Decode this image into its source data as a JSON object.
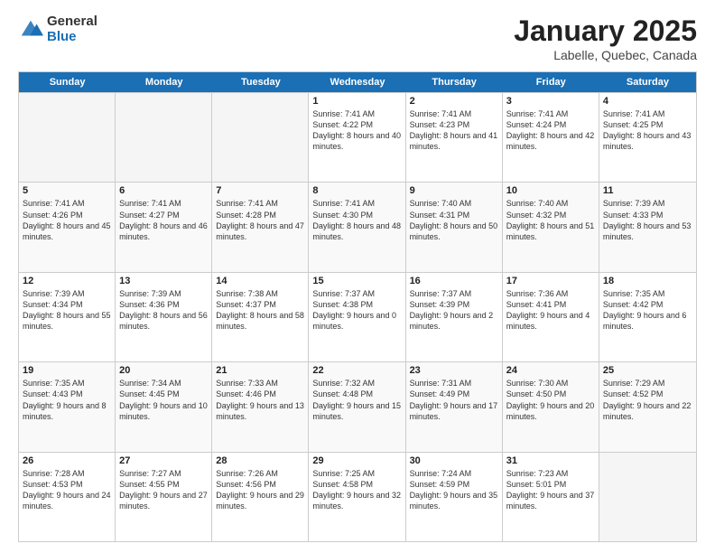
{
  "logo": {
    "general": "General",
    "blue": "Blue"
  },
  "title": "January 2025",
  "subtitle": "Labelle, Quebec, Canada",
  "days": [
    "Sunday",
    "Monday",
    "Tuesday",
    "Wednesday",
    "Thursday",
    "Friday",
    "Saturday"
  ],
  "rows": [
    [
      {
        "day": "",
        "empty": true
      },
      {
        "day": "",
        "empty": true
      },
      {
        "day": "",
        "empty": true
      },
      {
        "day": "1",
        "sunrise": "7:41 AM",
        "sunset": "4:22 PM",
        "daylight": "8 hours and 40 minutes."
      },
      {
        "day": "2",
        "sunrise": "7:41 AM",
        "sunset": "4:23 PM",
        "daylight": "8 hours and 41 minutes."
      },
      {
        "day": "3",
        "sunrise": "7:41 AM",
        "sunset": "4:24 PM",
        "daylight": "8 hours and 42 minutes."
      },
      {
        "day": "4",
        "sunrise": "7:41 AM",
        "sunset": "4:25 PM",
        "daylight": "8 hours and 43 minutes."
      }
    ],
    [
      {
        "day": "5",
        "sunrise": "7:41 AM",
        "sunset": "4:26 PM",
        "daylight": "8 hours and 45 minutes."
      },
      {
        "day": "6",
        "sunrise": "7:41 AM",
        "sunset": "4:27 PM",
        "daylight": "8 hours and 46 minutes."
      },
      {
        "day": "7",
        "sunrise": "7:41 AM",
        "sunset": "4:28 PM",
        "daylight": "8 hours and 47 minutes."
      },
      {
        "day": "8",
        "sunrise": "7:41 AM",
        "sunset": "4:30 PM",
        "daylight": "8 hours and 48 minutes."
      },
      {
        "day": "9",
        "sunrise": "7:40 AM",
        "sunset": "4:31 PM",
        "daylight": "8 hours and 50 minutes."
      },
      {
        "day": "10",
        "sunrise": "7:40 AM",
        "sunset": "4:32 PM",
        "daylight": "8 hours and 51 minutes."
      },
      {
        "day": "11",
        "sunrise": "7:39 AM",
        "sunset": "4:33 PM",
        "daylight": "8 hours and 53 minutes."
      }
    ],
    [
      {
        "day": "12",
        "sunrise": "7:39 AM",
        "sunset": "4:34 PM",
        "daylight": "8 hours and 55 minutes."
      },
      {
        "day": "13",
        "sunrise": "7:39 AM",
        "sunset": "4:36 PM",
        "daylight": "8 hours and 56 minutes."
      },
      {
        "day": "14",
        "sunrise": "7:38 AM",
        "sunset": "4:37 PM",
        "daylight": "8 hours and 58 minutes."
      },
      {
        "day": "15",
        "sunrise": "7:37 AM",
        "sunset": "4:38 PM",
        "daylight": "9 hours and 0 minutes."
      },
      {
        "day": "16",
        "sunrise": "7:37 AM",
        "sunset": "4:39 PM",
        "daylight": "9 hours and 2 minutes."
      },
      {
        "day": "17",
        "sunrise": "7:36 AM",
        "sunset": "4:41 PM",
        "daylight": "9 hours and 4 minutes."
      },
      {
        "day": "18",
        "sunrise": "7:35 AM",
        "sunset": "4:42 PM",
        "daylight": "9 hours and 6 minutes."
      }
    ],
    [
      {
        "day": "19",
        "sunrise": "7:35 AM",
        "sunset": "4:43 PM",
        "daylight": "9 hours and 8 minutes."
      },
      {
        "day": "20",
        "sunrise": "7:34 AM",
        "sunset": "4:45 PM",
        "daylight": "9 hours and 10 minutes."
      },
      {
        "day": "21",
        "sunrise": "7:33 AM",
        "sunset": "4:46 PM",
        "daylight": "9 hours and 13 minutes."
      },
      {
        "day": "22",
        "sunrise": "7:32 AM",
        "sunset": "4:48 PM",
        "daylight": "9 hours and 15 minutes."
      },
      {
        "day": "23",
        "sunrise": "7:31 AM",
        "sunset": "4:49 PM",
        "daylight": "9 hours and 17 minutes."
      },
      {
        "day": "24",
        "sunrise": "7:30 AM",
        "sunset": "4:50 PM",
        "daylight": "9 hours and 20 minutes."
      },
      {
        "day": "25",
        "sunrise": "7:29 AM",
        "sunset": "4:52 PM",
        "daylight": "9 hours and 22 minutes."
      }
    ],
    [
      {
        "day": "26",
        "sunrise": "7:28 AM",
        "sunset": "4:53 PM",
        "daylight": "9 hours and 24 minutes."
      },
      {
        "day": "27",
        "sunrise": "7:27 AM",
        "sunset": "4:55 PM",
        "daylight": "9 hours and 27 minutes."
      },
      {
        "day": "28",
        "sunrise": "7:26 AM",
        "sunset": "4:56 PM",
        "daylight": "9 hours and 29 minutes."
      },
      {
        "day": "29",
        "sunrise": "7:25 AM",
        "sunset": "4:58 PM",
        "daylight": "9 hours and 32 minutes."
      },
      {
        "day": "30",
        "sunrise": "7:24 AM",
        "sunset": "4:59 PM",
        "daylight": "9 hours and 35 minutes."
      },
      {
        "day": "31",
        "sunrise": "7:23 AM",
        "sunset": "5:01 PM",
        "daylight": "9 hours and 37 minutes."
      },
      {
        "day": "",
        "empty": true
      }
    ]
  ],
  "labels": {
    "sunrise_prefix": "Sunrise:",
    "sunset_prefix": "Sunset:",
    "daylight_prefix": "Daylight:"
  }
}
